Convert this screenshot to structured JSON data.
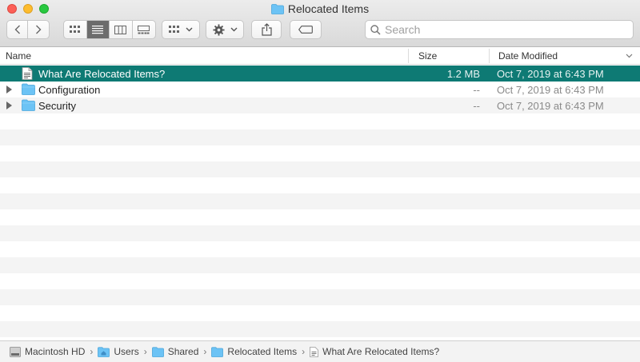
{
  "window": {
    "title": "Relocated Items"
  },
  "toolbar": {
    "search_placeholder": "Search"
  },
  "columns": {
    "name": "Name",
    "size": "Size",
    "date_modified": "Date Modified"
  },
  "files": [
    {
      "name": "What Are Relocated Items?",
      "size": "1.2 MB",
      "date": "Oct 7, 2019 at 6:43 PM",
      "kind": "document",
      "selected": true
    },
    {
      "name": "Configuration",
      "size": "--",
      "date": "Oct 7, 2019 at 6:43 PM",
      "kind": "folder",
      "selected": false
    },
    {
      "name": "Security",
      "size": "--",
      "date": "Oct 7, 2019 at 6:43 PM",
      "kind": "folder",
      "selected": false
    }
  ],
  "pathbar": {
    "items": [
      "Macintosh HD",
      "Users",
      "Shared",
      "Relocated Items",
      "What Are Relocated Items?"
    ]
  },
  "colors": {
    "selection": "#0e7a74",
    "folder": "#6cc3f5"
  }
}
